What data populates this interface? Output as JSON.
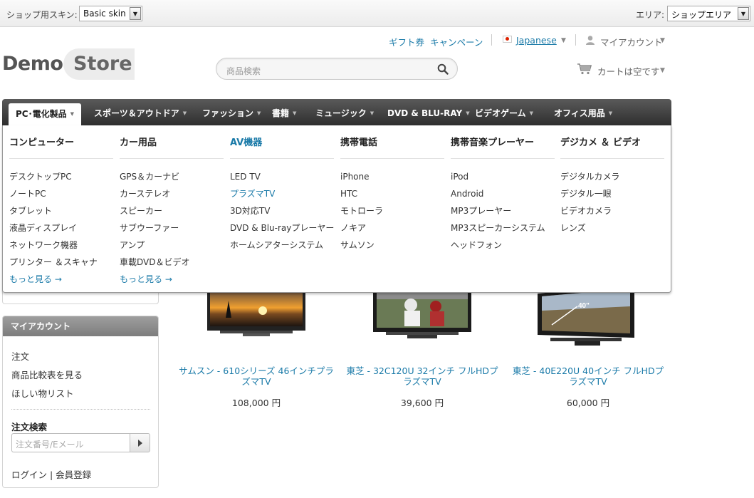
{
  "topbar": {
    "skin_label": "ショップ用スキン:",
    "skin_value": "Basic skin",
    "area_label": "エリア:",
    "area_value": "ショップエリア"
  },
  "header": {
    "logo_demo": "Demo",
    "logo_store": "Store",
    "links": {
      "gift": "ギフト券",
      "campaign": "キャンペーン"
    },
    "language": "Japanese",
    "account": "マイアカウント",
    "search_placeholder": "商品検索",
    "cart": "カートは空です"
  },
  "nav": {
    "items": [
      "PC･電化製品",
      "スポーツ＆アウトドア",
      "ファッション",
      "書籍",
      "ミュージック",
      "DVD & BLU-RAY",
      "ビデオゲーム",
      "オフィス用品"
    ]
  },
  "mega_menu": {
    "columns": [
      {
        "title": "コンピューター",
        "items": [
          "デスクトップPC",
          "ノートPC",
          "タブレット",
          "液晶ディスプレイ",
          "ネットワーク機器",
          "プリンター ＆スキャナ"
        ],
        "more": "もっと見る →"
      },
      {
        "title": "カー用品",
        "items": [
          "GPS＆カーナビ",
          "カーステレオ",
          "スピーカー",
          "サブウーファー",
          "アンプ",
          "車載DVD＆ビデオ"
        ],
        "more": "もっと見る →"
      },
      {
        "title": "AV機器",
        "items": [
          "LED TV",
          "プラズマTV",
          "3D対応TV",
          "DVD & Blu-rayプレーヤー",
          "ホームシアターシステム"
        ]
      },
      {
        "title": "携帯電話",
        "items": [
          "iPhone",
          "HTC",
          "モトローラ",
          "ノキア",
          "サムソン"
        ]
      },
      {
        "title": "携帯音楽プレーヤー",
        "items": [
          "iPod",
          "Android",
          "MP3プレーヤー",
          "MP3スピーカーシステム",
          "ヘッドフォン"
        ]
      },
      {
        "title": "デジカメ ＆ ビデオ",
        "items": [
          "デジタルカメラ",
          "デジタル一眼",
          "ビデオカメラ",
          "レンズ"
        ]
      }
    ]
  },
  "sidebar": {
    "account_title": "マイアカウント",
    "links": [
      "注文",
      "商品比較表を見る",
      "ほしい物リスト"
    ],
    "order_search_title": "注文検索",
    "order_placeholder": "注文番号/Eメール",
    "login": "ログイン | 会員登録"
  },
  "products": [
    {
      "name": "サムスン - 610シリーズ 46インチプラズマTV",
      "price": "108,000 円"
    },
    {
      "name": "東芝 - 32C120U 32インチ フルHDプラズマTV",
      "price": "39,600 円"
    },
    {
      "name": "東芝 - 40E220U 40インチ フルHDプラズマTV",
      "price": "60,000 円",
      "badge": "40\""
    }
  ]
}
